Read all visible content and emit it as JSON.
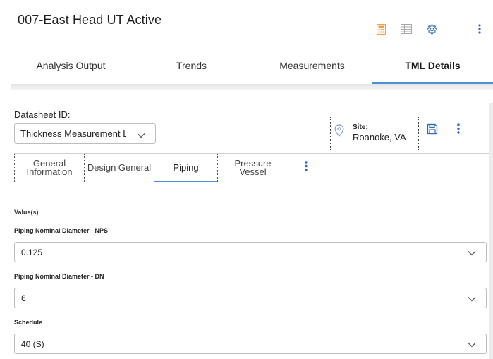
{
  "header": {
    "title": "007-East Head UT Active",
    "icons": [
      "calculator-icon",
      "table-grid-icon",
      "gear-icon",
      "more-vertical-icon"
    ],
    "colors": {
      "calculator": "#f0a040",
      "grid": "#a8a8a8",
      "gear": "#4a7fc1",
      "more": "#2a6cc2"
    }
  },
  "tabs": [
    {
      "label": "Analysis Output"
    },
    {
      "label": "Trends"
    },
    {
      "label": "Measurements"
    },
    {
      "label": "TML Details",
      "active": true
    }
  ],
  "datasheet": {
    "label": "Datasheet ID:",
    "value": "Thickness Measurement Lc"
  },
  "site": {
    "label": "Site:",
    "value": "Roanoke, VA"
  },
  "subtabs": [
    {
      "label1": "General",
      "label2": "Information"
    },
    {
      "label1": "Design General",
      "label2": ""
    },
    {
      "label1": "Piping",
      "label2": "",
      "active": true
    },
    {
      "label1": "Pressure",
      "label2": "Vessel"
    }
  ],
  "form": {
    "section_label": "Value(s)",
    "fields": [
      {
        "label": "Piping Nominal Diameter - NPS",
        "value": "0.125"
      },
      {
        "label": "Piping Nominal Diameter - DN",
        "value": "6"
      },
      {
        "label": "Schedule",
        "value": "40 (S)"
      }
    ]
  },
  "accent_color": "#4a90d9"
}
